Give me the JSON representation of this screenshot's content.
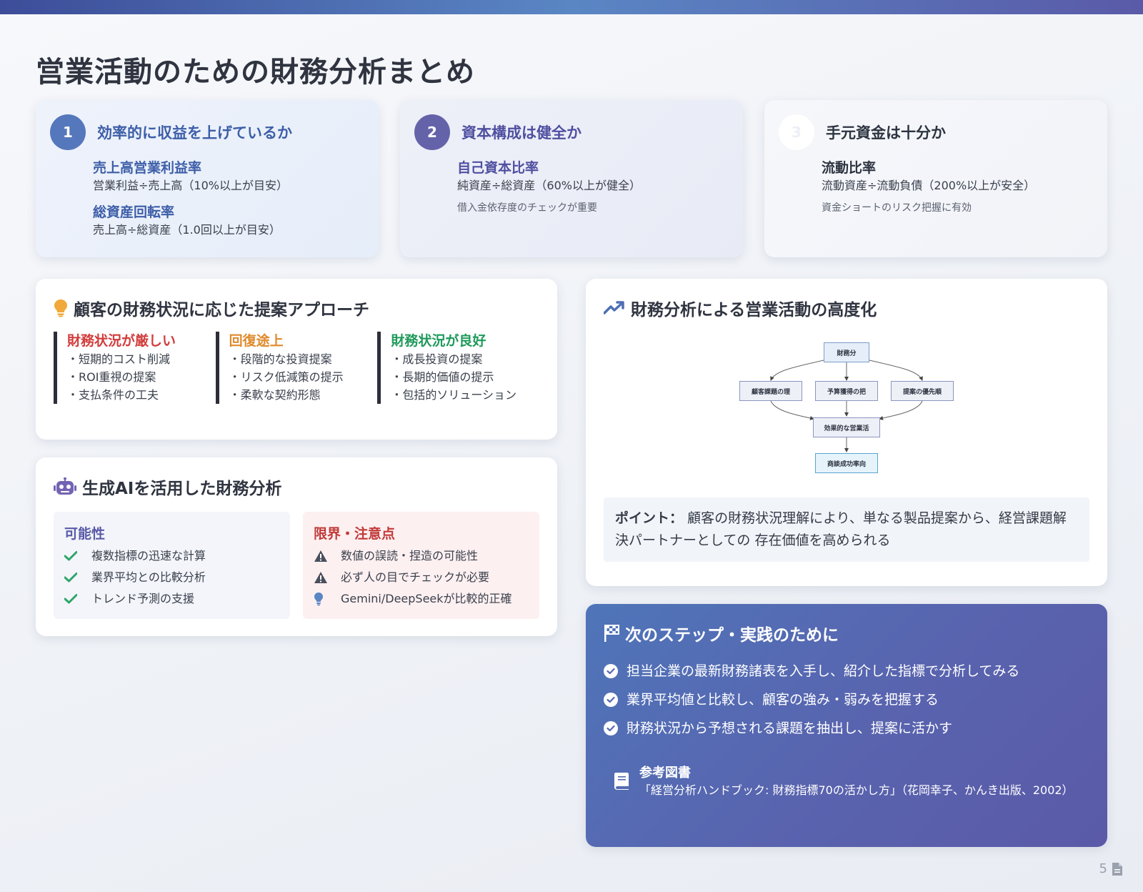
{
  "page_title": "営業活動のための財務分析まとめ",
  "summary": [
    {
      "num": "1",
      "title": "効率的に収益を上げているか",
      "metrics": [
        {
          "name": "売上高営業利益率",
          "formula": "営業利益÷売上高（10%以上が目安）"
        },
        {
          "name": "総資産回転率",
          "formula": "売上高÷総資産（1.0回以上が目安）"
        }
      ]
    },
    {
      "num": "2",
      "title": "資本構成は健全か",
      "metric": {
        "name": "自己資本比率",
        "formula": "純資産÷総資産（60%以上が健全）"
      },
      "note": "借入金依存度のチェックが重要"
    },
    {
      "num": "3",
      "title": "手元資金は十分か",
      "metric": {
        "name": "流動比率",
        "formula": "流動資産÷流動負債（200%以上が安全）"
      },
      "note": "資金ショートのリスク把握に有効"
    }
  ],
  "proposal": {
    "title": "顧客の財務状況に応じた提案アプローチ",
    "columns": [
      {
        "title": "財務状況が厳しい",
        "color": "#d23c3c",
        "items": [
          "・短期的コスト削減",
          "・ROI重視の提案",
          "・支払条件の工夫"
        ]
      },
      {
        "title": "回復途上",
        "color": "#e08a2c",
        "items": [
          "・段階的な投資提案",
          "・リスク低減策の提示",
          "・柔軟な契約形態"
        ]
      },
      {
        "title": "財務状況が良好",
        "color": "#1f9a5b",
        "items": [
          "・成長投資の提案",
          "・長期的価値の提示",
          "・包括的ソリューション"
        ]
      }
    ]
  },
  "ai": {
    "title": "生成AIを活用した財務分析",
    "pros_title": "可能性",
    "pros": [
      "複数指標の迅速な計算",
      "業界平均との比較分析",
      "トレンド予測の支援"
    ],
    "cons_title": "限界・注意点",
    "cons": [
      "数値の誤読・捏造の可能性",
      "必ず人の目でチェックが必要",
      "Gemini/DeepSeekが比較的正確"
    ]
  },
  "sales": {
    "title": "財務分析による営業活動の高度化",
    "flow": {
      "top": "財務分",
      "mid": [
        "顧客課題の理",
        "予算獲得の把",
        "提案の優先順"
      ],
      "merge": "効果的な営業活",
      "end": "商談成功率向"
    },
    "point_label": "ポイント：",
    "point_text": "顧客の財務状況理解により、単なる製品提案から、経営課題解決パートナーとしての 存在価値を高められる"
  },
  "next": {
    "title": "次のステップ・実践のために",
    "items": [
      "担当企業の最新財務諸表を入手し、紹介した指標で分析してみる",
      "業界平均値と比較し、顧客の強み・弱みを把握する",
      "財務状況から予想される課題を抽出し、提案に活かす"
    ],
    "ref_title": "参考図書",
    "ref_text": "「経営分析ハンドブック: 財務指標70の活かし方」（花岡幸子、かんき出版、2002）"
  },
  "page_number": "5",
  "icons": {
    "proposal": "lightbulb-icon",
    "ai": "robot-icon",
    "sales": "trend-up-icon",
    "next": "flag-icon",
    "pros": "check-icon",
    "cons": "warning-icon",
    "cons_tip": "lightbulb-icon",
    "next_item": "check-circle-icon",
    "ref": "book-icon",
    "page": "document-icon"
  },
  "colors": {
    "accent_blue": "#5577bb",
    "accent_purple": "#5a5aa8",
    "danger": "#c23a3a",
    "success": "#1f9a5b",
    "warning": "#e08a2c"
  }
}
